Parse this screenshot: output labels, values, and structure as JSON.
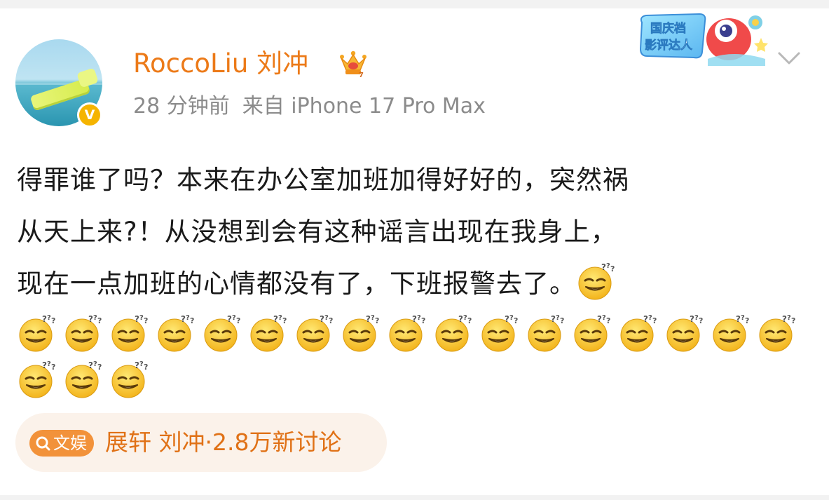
{
  "post": {
    "author": {
      "name": "RoccoLiu 刘冲",
      "avatar_icon": "avatar-pool-float",
      "verified_badge_text": "V",
      "vip_icon": "crown-vip-icon"
    },
    "time": "28 分钟前",
    "source": "来自 iPhone 17 Pro Max",
    "event_badge": {
      "line1": "国庆档",
      "line2": "影评达人"
    },
    "text_lines": [
      "得罪谁了吗？本来在办公室加班加得好好的，突然祸",
      "从天上来?！从没想到会有这种谣言出现在我身上，",
      "现在一点加班的心情都没有了，下班报警去了。"
    ],
    "emoji_name": "dizzy-smile-emoji",
    "emoji_count": 21,
    "topic": {
      "tag_label": "文娱",
      "names": "展轩 刘冲",
      "discussion": "·2.8万新讨论"
    }
  },
  "colors": {
    "accent": "#ec7a18",
    "meta": "#8b8b8b",
    "topic_bg": "#fbf2ea",
    "topic_tag_bg": "#f2923a",
    "verified": "#f5b400"
  }
}
